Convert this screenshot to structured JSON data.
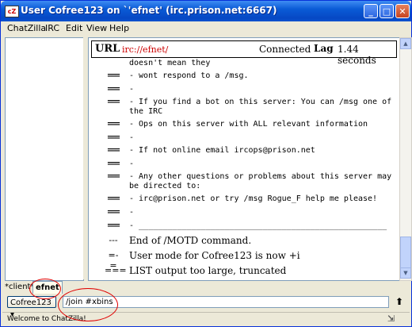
{
  "window": {
    "title": "User Cofree123 on `'efnet' (irc.prison.net:6667)",
    "app_icon_label": "cZ",
    "min_glyph": "_",
    "max_glyph": "□",
    "close_glyph": "✕"
  },
  "menubar": [
    "ChatZilla",
    "IRC",
    "Edit",
    "View",
    "Help"
  ],
  "urlbar": {
    "label": "URL",
    "url": "irc://efnet/",
    "status": "Connected",
    "lag_label": "Lag",
    "lag_value": "1.44 seconds"
  },
  "messages": [
    {
      "code": "",
      "text": "doesn't mean they"
    },
    {
      "code": "===",
      "text": "- wont respond to a /msg."
    },
    {
      "code": "===",
      "text": "-"
    },
    {
      "code": "===",
      "text": "- If you find a bot on this server: You can /msg one of the IRC"
    },
    {
      "code": "===",
      "text": "- Ops on this server with ALL relevant information"
    },
    {
      "code": "===",
      "text": "-"
    },
    {
      "code": "===",
      "text": "- If not online email ircops@prison.net"
    },
    {
      "code": "===",
      "text": "-"
    },
    {
      "code": "===",
      "text": "- Any other questions or problems about this server may be directed to:"
    },
    {
      "code": "===",
      "text": "- irc@prison.net or try /msg Rogue_F help me please!"
    },
    {
      "code": "===",
      "text": "-"
    },
    {
      "code": "===",
      "text": "- ____________________________________________________"
    },
    {
      "code": "---",
      "text": "End of /MOTD command."
    },
    {
      "code": "=-=",
      "text": "User mode for Cofree123 is now +i"
    },
    {
      "code": "===",
      "text": "LIST output too large, truncated"
    }
  ],
  "tabs": {
    "client": "*client*",
    "efnet": "efnet"
  },
  "nick": {
    "label": "Cofree123",
    "caret": "▾"
  },
  "input": {
    "value": "/join #xbins"
  },
  "send_arrow": "⬆",
  "statusbar": {
    "text": "Welcome to ChatZilla!"
  },
  "colors": {
    "titlebar": "#0a5bd6",
    "link": "#cc0000",
    "annotation": "#e00000"
  }
}
